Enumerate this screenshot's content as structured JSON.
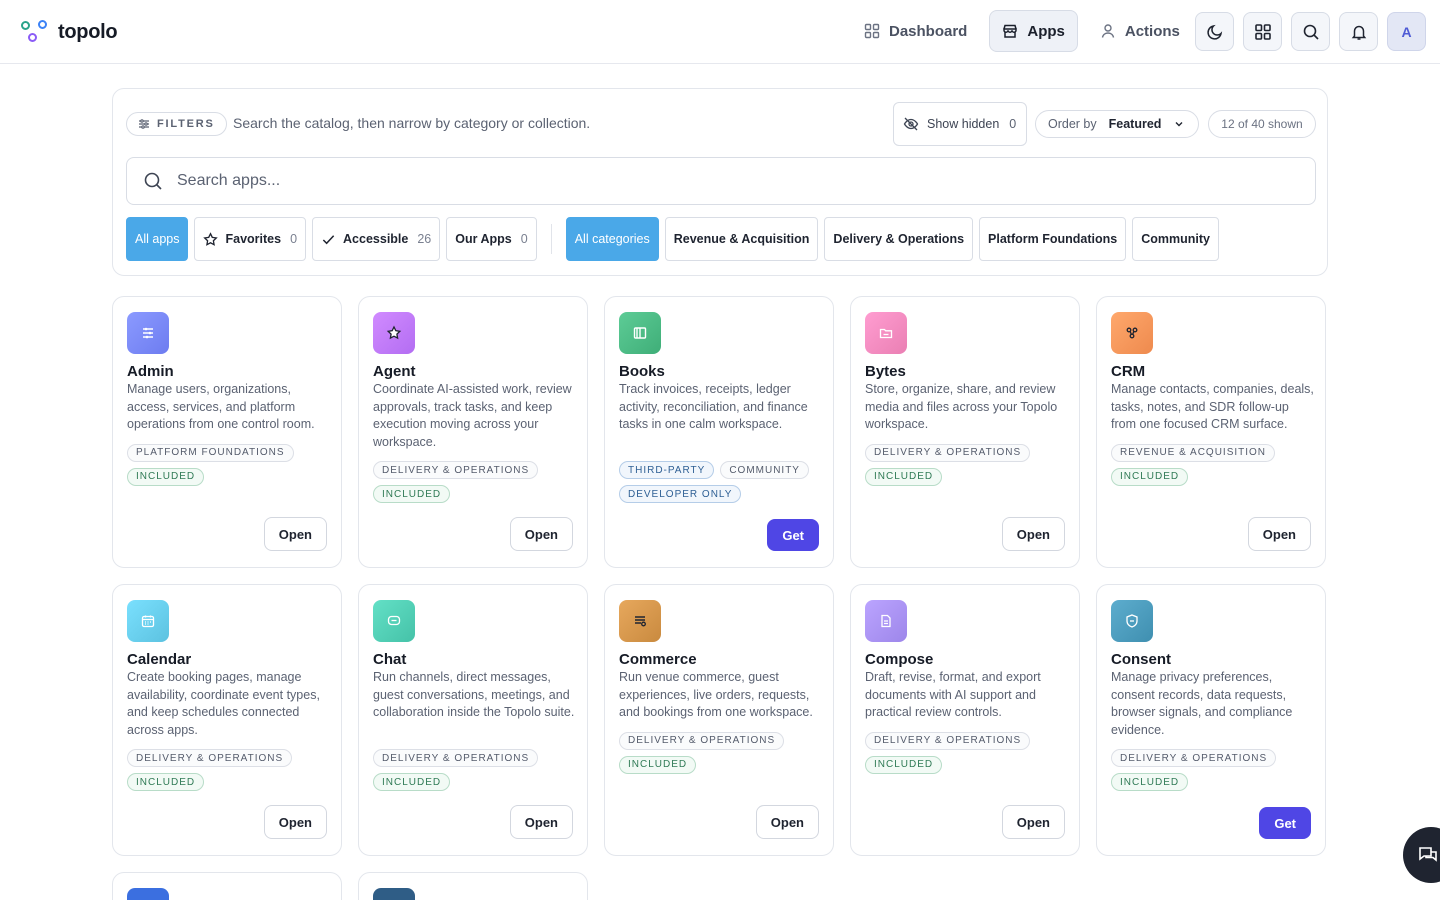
{
  "brand": {
    "name": "topolo"
  },
  "nav": {
    "dashboard": "Dashboard",
    "apps": "Apps",
    "actions": "Actions",
    "avatar_initial": "A"
  },
  "filters": {
    "label": "FILTERS",
    "hint": "Search the catalog, then narrow by category or collection.",
    "show_hidden_label": "Show hidden",
    "show_hidden_count": "0",
    "order_by_label": "Order by",
    "order_by_value": "Featured",
    "shown": "12 of 40 shown",
    "search_placeholder": "Search apps...",
    "collections": [
      {
        "label": "All apps",
        "count": ""
      },
      {
        "label": "Favorites",
        "count": "0"
      },
      {
        "label": "Accessible",
        "count": "26"
      },
      {
        "label": "Our Apps",
        "count": "0"
      }
    ],
    "categories": [
      "All categories",
      "Revenue & Acquisition",
      "Delivery & Operations",
      "Platform Foundations",
      "Community"
    ]
  },
  "apps": [
    {
      "name": "Admin",
      "description": "Manage users, organizations, access, services, and platform operations from one control room.",
      "tags": [
        "PLATFORM FOUNDATIONS"
      ],
      "status": [
        "INCLUDED"
      ],
      "action": "Open",
      "icon": "sliders-icon",
      "color": "#6d7cf0"
    },
    {
      "name": "Agent",
      "description": "Coordinate AI-assisted work, review approvals, track tasks, and keep execution moving across your workspace.",
      "tags": [
        "DELIVERY & OPERATIONS"
      ],
      "status": [
        "INCLUDED"
      ],
      "action": "Open",
      "icon": "star-icon",
      "color": "#b36df2"
    },
    {
      "name": "Books",
      "description": "Track invoices, receipts, ledger activity, reconciliation, and finance tasks in one calm workspace.",
      "tags": [
        "THIRD-PARTY",
        "COMMUNITY"
      ],
      "status": [
        "DEVELOPER ONLY"
      ],
      "action": "Get",
      "icon": "book-icon",
      "color": "#3fae78"
    },
    {
      "name": "Bytes",
      "description": "Store, organize, share, and review media and files across your Topolo workspace.",
      "tags": [
        "DELIVERY & OPERATIONS"
      ],
      "status": [
        "INCLUDED"
      ],
      "action": "Open",
      "icon": "folder-icon",
      "color": "#ea7fb3"
    },
    {
      "name": "CRM",
      "description": "Manage contacts, companies, deals, tasks, notes, and SDR follow-up from one focused CRM surface.",
      "tags": [
        "REVENUE & ACQUISITION"
      ],
      "status": [
        "INCLUDED"
      ],
      "action": "Open",
      "icon": "network-icon",
      "color": "#ee8a4e"
    },
    {
      "name": "Calendar",
      "description": "Create booking pages, manage availability, coordinate event types, and keep schedules connected across apps.",
      "tags": [
        "DELIVERY & OPERATIONS"
      ],
      "status": [
        "INCLUDED"
      ],
      "action": "Open",
      "icon": "calendar-icon",
      "color": "#5cc2e0"
    },
    {
      "name": "Chat",
      "description": "Run channels, direct messages, guest conversations, meetings, and collaboration inside the Topolo suite.",
      "tags": [
        "DELIVERY & OPERATIONS"
      ],
      "status": [
        "INCLUDED"
      ],
      "action": "Open",
      "icon": "message-icon",
      "color": "#45c2a8"
    },
    {
      "name": "Commerce",
      "description": "Run venue commerce, guest experiences, live orders, requests, and bookings from one workspace.",
      "tags": [
        "DELIVERY & OPERATIONS"
      ],
      "status": [
        "INCLUDED"
      ],
      "action": "Open",
      "icon": "receipt-icon",
      "color": "#c98a3f"
    },
    {
      "name": "Compose",
      "description": "Draft, revise, format, and export documents with AI support and practical review controls.",
      "tags": [
        "DELIVERY & OPERATIONS"
      ],
      "status": [
        "INCLUDED"
      ],
      "action": "Open",
      "icon": "document-icon",
      "color": "#9d86ea"
    },
    {
      "name": "Consent",
      "description": "Manage privacy preferences, consent records, data requests, browser signals, and compliance evidence.",
      "tags": [
        "DELIVERY & OPERATIONS"
      ],
      "status": [
        "INCLUDED"
      ],
      "action": "Get",
      "icon": "shield-icon",
      "color": "#3f8fb0"
    }
  ]
}
